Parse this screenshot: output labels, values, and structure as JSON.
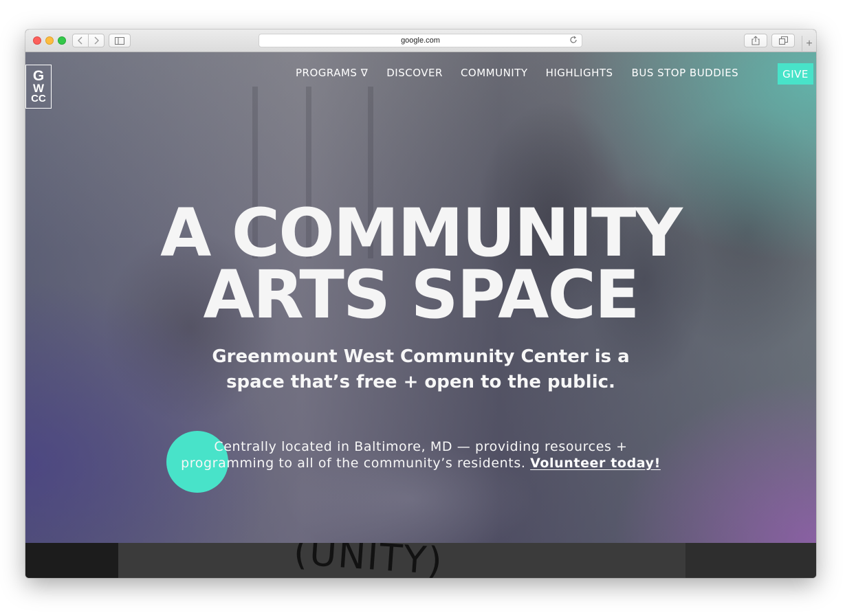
{
  "browser": {
    "url": "google.com"
  },
  "logo": {
    "line1": "G",
    "line2": "W",
    "line3": "CC"
  },
  "nav": {
    "programs": "PROGRAMS ∇",
    "discover": "DISCOVER",
    "community": "COMMUNITY",
    "highlights": "HIGHLIGHTS",
    "bus_stop_buddies": "BUS STOP BUDDIES",
    "give": "GIVE"
  },
  "hero": {
    "headline_line1": "A COMMUNITY",
    "headline_line2": "ARTS SPACE",
    "subhead": "Greenmount West Community Center is a space that’s free + open to the public.",
    "desc_line1": "Centrally located in Baltimore, MD — providing resources +",
    "desc_line2": "programming to all of the community’s residents.",
    "volunteer_link": "Volunteer today!"
  },
  "strip": {
    "sign_text": "(UNITY)"
  },
  "colors": {
    "accent": "#48e3c9",
    "text": "#ffffff"
  }
}
